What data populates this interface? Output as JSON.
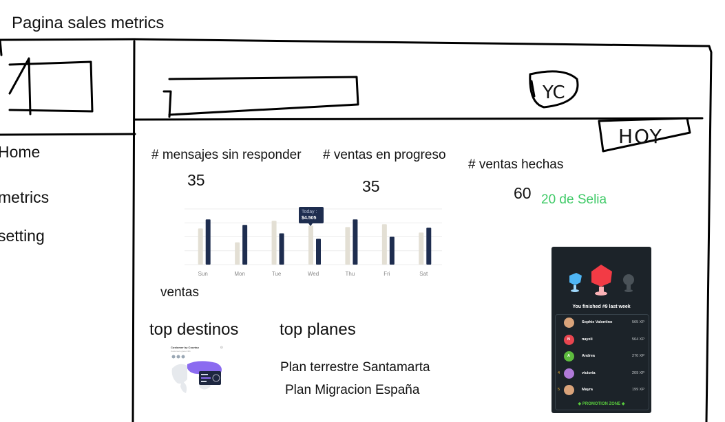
{
  "page_title": "Pagina sales metrics",
  "header": {
    "logo_scribble": "YC",
    "tab_scribble": "HOY"
  },
  "sidebar": {
    "items": [
      {
        "label": "Home"
      },
      {
        "label": "metrics"
      },
      {
        "label": "setting"
      }
    ]
  },
  "metrics": [
    {
      "label": "# mensajes sin responder",
      "value": "35"
    },
    {
      "label": "# ventas en progreso",
      "value": "35"
    },
    {
      "label": "# ventas hechas",
      "value": "60"
    }
  ],
  "metric_note": "20 de Selia",
  "sales_chart": {
    "label": "ventas",
    "tooltip": {
      "title": "Today :",
      "value": "$4.505"
    },
    "colors": {
      "light": "#e3dfd4",
      "dark": "#1e2d4f"
    }
  },
  "chart_data": {
    "type": "bar",
    "categories": [
      "Sun",
      "Mon",
      "Tue",
      "Wed",
      "Thu",
      "Fri",
      "Sat"
    ],
    "series": [
      {
        "values": [
          52,
          32,
          63,
          56,
          54,
          58,
          46
        ]
      },
      {
        "values": [
          65,
          57,
          45,
          37,
          65,
          40,
          53
        ]
      }
    ],
    "ylim": [
      0,
      80
    ],
    "grid": true
  },
  "sections": {
    "top_destinos": "top destinos",
    "top_planes": "top planes"
  },
  "plans": [
    {
      "label": "Plan terrestre Santamarta"
    },
    {
      "label": "Plan Migracion España"
    }
  ],
  "map_card": {
    "title": "Customer by Country",
    "subtitle": "Customers grew 43%"
  },
  "leaderboard": {
    "heading": "You finished #9 last week",
    "promo": "◆ PROMOTION ZONE ◆",
    "rows": [
      {
        "rank": "",
        "initial": "",
        "name": "Sophie Valentino",
        "xp": "565 XP",
        "color": "#d9a37a"
      },
      {
        "rank": "",
        "initial": "N",
        "name": "nayeli",
        "xp": "564 XP",
        "color": "#e8454f"
      },
      {
        "rank": "",
        "initial": "A",
        "name": "Andrea",
        "xp": "270 XP",
        "color": "#5dbb3e"
      },
      {
        "rank": "4",
        "initial": "",
        "name": "victoria",
        "xp": "209 XP",
        "color": "#b07ad9"
      },
      {
        "rank": "5",
        "initial": "",
        "name": "Mayra",
        "xp": "199 XP",
        "color": "#d9a37a"
      }
    ]
  }
}
